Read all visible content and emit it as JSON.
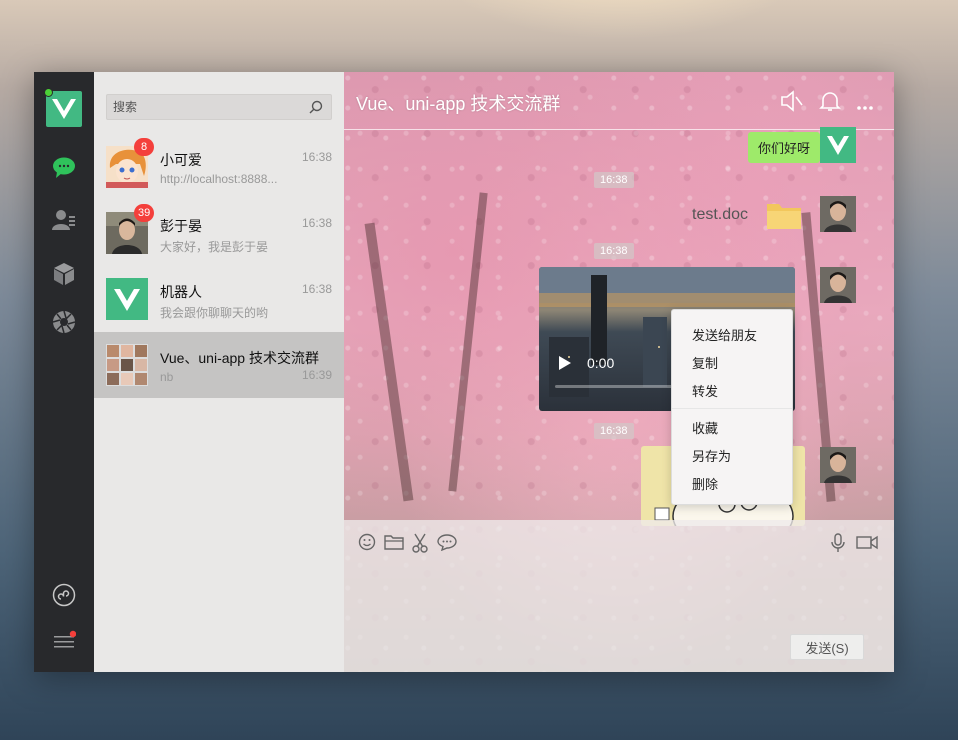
{
  "search": {
    "placeholder": "搜索"
  },
  "conversations": [
    {
      "name": "小可爱",
      "time": "16:38",
      "message": "http://localhost:8888...",
      "badge": "8"
    },
    {
      "name": "彭于晏",
      "time": "16:38",
      "message": "大家好，我是彭于晏",
      "badge": "39"
    },
    {
      "name": "机器人",
      "time": "16:38",
      "message": "我会跟你聊聊天的哟",
      "badge": ""
    },
    {
      "name": "Vue、uni-app 技术交流群",
      "time": "16:39",
      "message": "nb",
      "badge": ""
    }
  ],
  "chat": {
    "title": "Vue、uni-app 技术交流群",
    "messages": {
      "greeting": "你们好呀",
      "file_name": "test.doc",
      "video_time": "0:00"
    },
    "timestamps": [
      "16:38",
      "16:38",
      "16:38"
    ],
    "context_menu": [
      "发送给朋友",
      "复制",
      "转发",
      "收藏",
      "另存为",
      "删除"
    ],
    "send_label": "发送(S)"
  },
  "colors": {
    "accent": "#42b983",
    "bubble": "#9eea6a",
    "badge": "#f43f3b"
  }
}
